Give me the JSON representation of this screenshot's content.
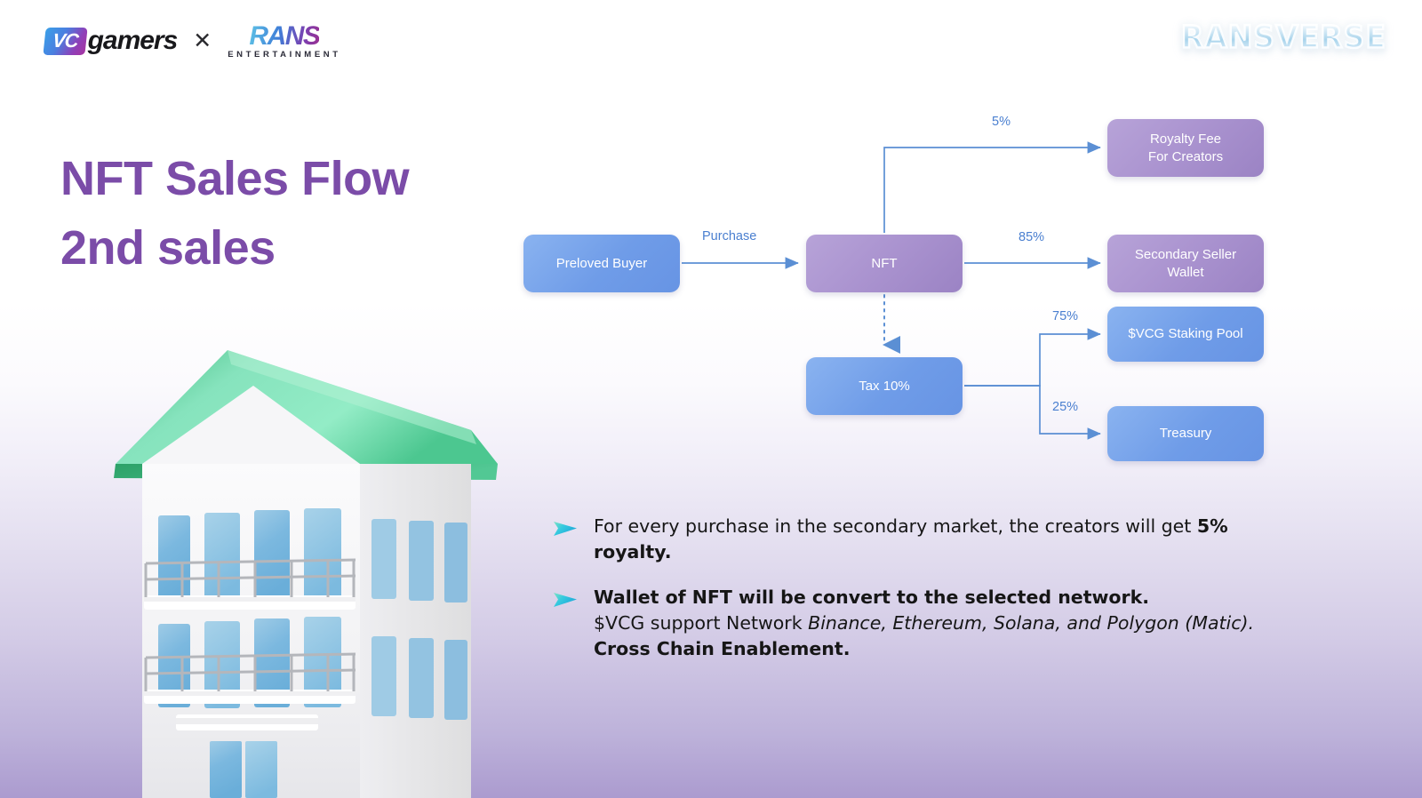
{
  "header": {
    "brand_primary_badge": "VC",
    "brand_primary_word": "gamers",
    "collab_symbol": "✕",
    "brand_secondary_word": "RANS",
    "brand_secondary_sub": "ENTERTAINMENT",
    "product_logo": "RANSVERSE"
  },
  "title": {
    "line1": "NFT Sales Flow",
    "line2": "2nd sales"
  },
  "chart_data": {
    "type": "diagram",
    "title": "NFT Sales Flow 2nd sales",
    "nodes": [
      {
        "id": "buyer",
        "label": "Preloved Buyer",
        "color": "#6f9ce8"
      },
      {
        "id": "nft",
        "label": "NFT",
        "color": "#ab94d0"
      },
      {
        "id": "royalty",
        "label": "Royalty Fee\nFor Creators",
        "color": "#ab94d0"
      },
      {
        "id": "secondary",
        "label": "Secondary Seller\nWallet",
        "color": "#ab94d0"
      },
      {
        "id": "tax",
        "label": "Tax 10%",
        "color": "#6f9ce8"
      },
      {
        "id": "staking",
        "label": "$VCG Staking Pool",
        "color": "#6f9ce8"
      },
      {
        "id": "treasury",
        "label": "Treasury",
        "color": "#6f9ce8"
      }
    ],
    "edges": [
      {
        "from": "buyer",
        "to": "nft",
        "label": "Purchase",
        "style": "solid"
      },
      {
        "from": "nft",
        "to": "royalty",
        "label": "5%",
        "style": "solid"
      },
      {
        "from": "nft",
        "to": "secondary",
        "label": "85%",
        "style": "solid"
      },
      {
        "from": "nft",
        "to": "tax",
        "label": "",
        "style": "dotted"
      },
      {
        "from": "tax",
        "to": "staking",
        "label": "75%",
        "style": "solid"
      },
      {
        "from": "tax",
        "to": "treasury",
        "label": "25%",
        "style": "solid"
      }
    ],
    "edge_color": "#5b8fd4"
  },
  "diagram": {
    "nodes": {
      "buyer": "Preloved Buyer",
      "nft": "NFT",
      "royalty_line1": "Royalty Fee",
      "royalty_line2": "For Creators",
      "secondary_line1": "Secondary Seller",
      "secondary_line2": "Wallet",
      "tax": "Tax 10%",
      "staking": "$VCG Staking Pool",
      "treasury": "Treasury"
    },
    "labels": {
      "purchase": "Purchase",
      "pct_royalty": "5%",
      "pct_secondary": "85%",
      "pct_staking": "75%",
      "pct_treasury": "25%"
    }
  },
  "bullets": [
    {
      "text_plain": "For every purchase in the secondary market, the creators will get ",
      "text_bold": "5% royalty."
    },
    {
      "heading": "Wallet of NFT will be convert to the selected network.",
      "line_prefix": "$VCG support Network ",
      "line_italic": "Binance, Ethereum, Solana, and Polygon (Matic).",
      "line_bold": "Cross Chain Enablement."
    }
  ],
  "colors": {
    "title_purple": "#7b4ca8",
    "node_blue": "#6f9ce8",
    "node_purple": "#ab94d0",
    "edge_blue": "#5b8fd4",
    "bullet_teal": "#35c9df",
    "background_bottom": "#ab9bcf"
  }
}
